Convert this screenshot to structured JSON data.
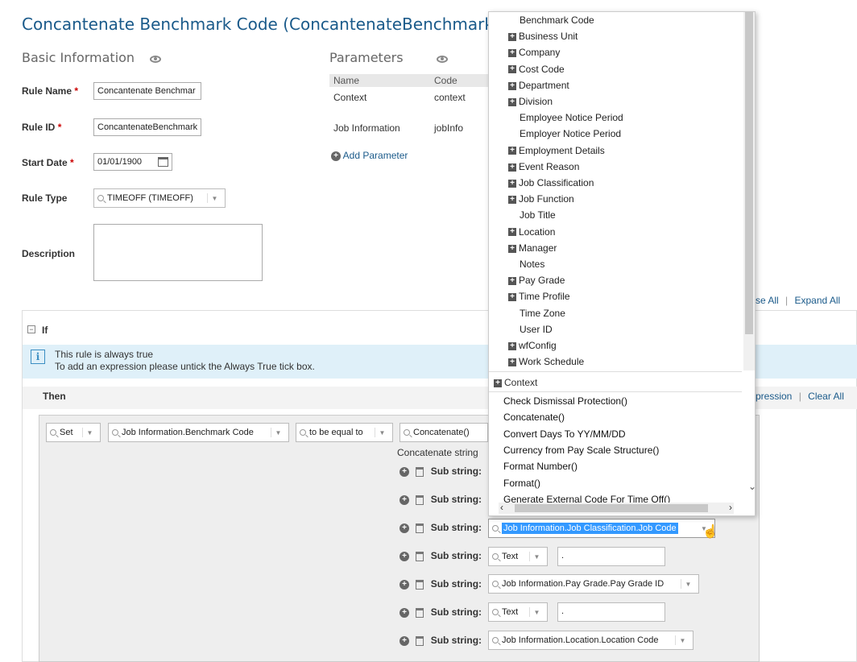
{
  "page": {
    "title": "Concantenate Benchmark Code (ConcantenateBenchmarkCode)"
  },
  "basic": {
    "heading": "Basic Information",
    "rule_name_label": "Rule Name",
    "rule_name_value": "Concantenate Benchmar",
    "rule_id_label": "Rule ID",
    "rule_id_value": "ConcantenateBenchmark",
    "start_date_label": "Start Date",
    "start_date_value": "01/01/1900",
    "rule_type_label": "Rule Type",
    "rule_type_value": "TIMEOFF (TIMEOFF)",
    "description_label": "Description",
    "required_mark": "*"
  },
  "params": {
    "heading": "Parameters",
    "col_name": "Name",
    "col_code": "Code",
    "rows": [
      {
        "name": "Context",
        "code": "context"
      },
      {
        "name": "Job Information",
        "code": "jobInfo"
      }
    ],
    "add_label": "Add Parameter"
  },
  "links": {
    "collapse_all": "se All",
    "expand_all": "Expand All",
    "expression": "pression",
    "clear_all": "Clear All",
    "sep": "|"
  },
  "if_section": {
    "label": "If",
    "info_line1": "This rule is always true",
    "info_line2": "To add an expression please untick the Always True tick box."
  },
  "then_section": {
    "label": "Then",
    "set_value": "Set",
    "field_value": "Job Information.Benchmark Code",
    "operator_value": "to be equal to",
    "function_value": "Concatenate()",
    "concat_label": "Concatenate string",
    "substring_label": "Sub string:",
    "substrings": [
      {
        "value": "Job Information.Job Classification.Job Code"
      },
      {
        "value": "Text",
        "text": "."
      },
      {
        "value": "Job Information.Pay Grade.Pay Grade ID"
      },
      {
        "value": "Text",
        "text": "."
      },
      {
        "value": "Job Information.Location.Location Code"
      }
    ]
  },
  "popup": {
    "tree": [
      {
        "label": "Benchmark Code",
        "expand": false
      },
      {
        "label": "Business Unit",
        "expand": true
      },
      {
        "label": "Company",
        "expand": true
      },
      {
        "label": "Cost Code",
        "expand": true
      },
      {
        "label": "Department",
        "expand": true
      },
      {
        "label": "Division",
        "expand": true
      },
      {
        "label": "Employee Notice Period",
        "expand": false
      },
      {
        "label": "Employer Notice Period",
        "expand": false
      },
      {
        "label": "Employment Details",
        "expand": true
      },
      {
        "label": "Event Reason",
        "expand": true
      },
      {
        "label": "Job Classification",
        "expand": true
      },
      {
        "label": "Job Function",
        "expand": true
      },
      {
        "label": "Job Title",
        "expand": false
      },
      {
        "label": "Location",
        "expand": true
      },
      {
        "label": "Manager",
        "expand": true
      },
      {
        "label": "Notes",
        "expand": false
      },
      {
        "label": "Pay Grade",
        "expand": true
      },
      {
        "label": "Time Profile",
        "expand": true
      },
      {
        "label": "Time Zone",
        "expand": false
      },
      {
        "label": "User ID",
        "expand": false
      },
      {
        "label": "wfConfig",
        "expand": true
      },
      {
        "label": "Work Schedule",
        "expand": true
      }
    ],
    "context_label": "Context",
    "functions": [
      "Check Dismissal Protection()",
      "Concatenate()",
      "Convert Days To YY/MM/DD",
      "Currency from Pay Scale Structure()",
      "Format Number()",
      "Format()",
      "Generate External Code For Time Off()"
    ]
  },
  "colors": {
    "accent": "#1a5a8a",
    "info_bg": "#dff0f9",
    "highlight": "#3399ff"
  }
}
